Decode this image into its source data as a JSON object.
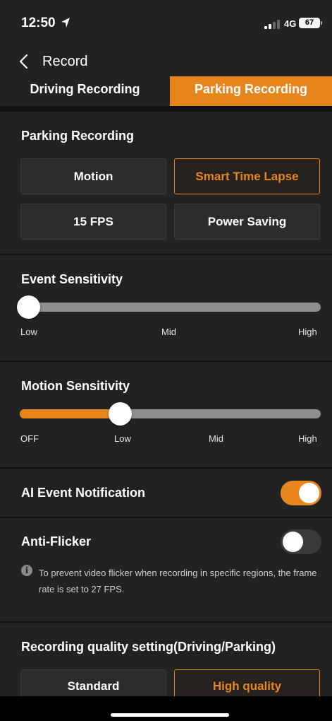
{
  "status_bar": {
    "time": "12:50",
    "network": "4G",
    "battery": "67",
    "location_icon": "location-arrow-icon",
    "signal_icon": "signal-bars-icon"
  },
  "nav": {
    "title": "Record",
    "back_icon": "chevron-left-icon"
  },
  "tabs": [
    {
      "label": "Driving Recording",
      "active": false
    },
    {
      "label": "Parking Recording",
      "active": true
    }
  ],
  "parking_recording": {
    "title": "Parking Recording",
    "options": [
      {
        "label": "Motion",
        "selected": false
      },
      {
        "label": "Smart Time Lapse",
        "selected": true
      },
      {
        "label": "15 FPS",
        "selected": false
      },
      {
        "label": "Power Saving",
        "selected": false
      }
    ]
  },
  "event_sensitivity": {
    "title": "Event Sensitivity",
    "ticks": [
      "Low",
      "Mid",
      "High"
    ],
    "value_fraction": 0.0
  },
  "motion_sensitivity": {
    "title": "Motion Sensitivity",
    "ticks": [
      "OFF",
      "Low",
      "Mid",
      "High"
    ],
    "value_fraction": 0.333
  },
  "ai_event_notification": {
    "label": "AI Event Notification",
    "enabled": true
  },
  "anti_flicker": {
    "label": "Anti-Flicker",
    "enabled": false,
    "info_icon": "info-icon",
    "info_text": "To prevent video flicker when recording in specific regions, the frame rate is set to 27 FPS."
  },
  "recording_quality": {
    "title": "Recording quality setting(Driving/Parking)",
    "options": [
      {
        "label": "Standard",
        "selected": false
      },
      {
        "label": "High quality",
        "selected": true
      }
    ]
  },
  "colors": {
    "accent": "#e8861e",
    "panel": "#222222",
    "background": "#111111",
    "track": "#8e8e8e"
  }
}
